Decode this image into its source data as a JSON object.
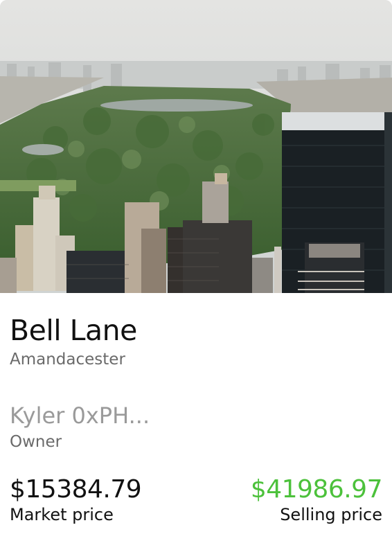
{
  "property": {
    "name": "Bell Lane",
    "location": "Amandacester",
    "image_alt": "Aerial view of a city park surrounded by skyscrapers"
  },
  "owner": {
    "name": "Kyler 0xPH...",
    "label": "Owner"
  },
  "prices": {
    "market_value": "$15384.79",
    "market_label": "Market price",
    "selling_value": "$41986.97",
    "selling_label": "Selling price"
  },
  "colors": {
    "selling_price": "#4cc13b",
    "title": "#111111",
    "muted": "#6a6a6a"
  }
}
